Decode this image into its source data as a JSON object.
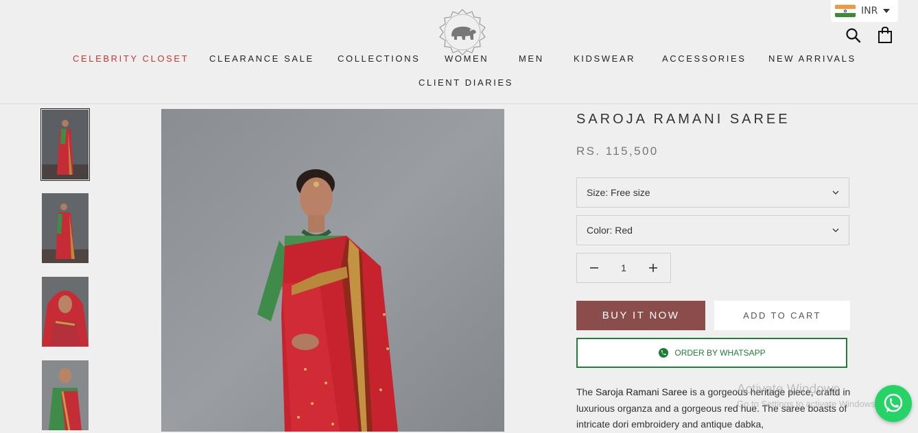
{
  "header": {
    "currency": "INR",
    "nav": [
      "CELEBRITY CLOSET",
      "CLEARANCE SALE",
      "COLLECTIONS",
      "WOMEN",
      "MEN",
      "KIDSWEAR",
      "ACCESSORIES",
      "NEW ARRIVALS",
      "CLIENT DIARIES"
    ]
  },
  "product": {
    "title": "SAROJA RAMANI SAREE",
    "price": "RS. 115,500",
    "size_label": "Size: Free size",
    "color_label": "Color: Red",
    "quantity": "1",
    "buy_now": "BUY IT NOW",
    "add_to_cart": "ADD TO CART",
    "whatsapp": "ORDER BY WHATSAPP",
    "description": {
      "prefix": "The ",
      "name": "Saroja Ramani Saree",
      "rest": " is a gorgeous heritage piece, craftd in luxurious organza and a gorgeous red hue. The saree boasts of intricate dori embroidery and antique dabka,"
    }
  },
  "watermark": {
    "line1": "Activate Windows",
    "line2": "Go to Settings to activate Windows."
  },
  "colors": {
    "nav_highlight": "#c8352e",
    "buy_now": "#8b4c4c",
    "whatsapp": "#1e7e34"
  }
}
